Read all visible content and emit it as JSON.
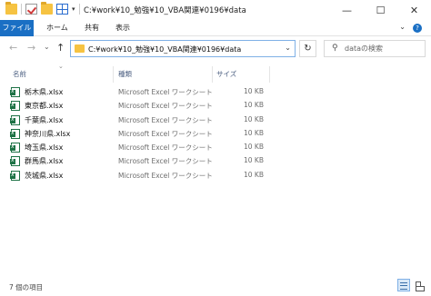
{
  "window": {
    "title": "C:¥work¥10_勉強¥10_VBA関連¥0196¥data",
    "minimize": "—",
    "maximize": "☐",
    "close": "✕"
  },
  "ribbon": {
    "tabs": [
      "ファイル",
      "ホーム",
      "共有",
      "表示"
    ],
    "help": "?",
    "expand": "⌄"
  },
  "nav": {
    "back": "←",
    "forward": "→",
    "recent": "⌄",
    "up": "↑",
    "address": "C:¥work¥10_勉強¥10_VBA関連¥0196¥data",
    "address_dropdown": "⌄",
    "refresh": "↻",
    "search_placeholder": "dataの検索",
    "search_icon": "⚲"
  },
  "columns": {
    "sort_indicator": "⌄",
    "name": "名前",
    "type": "種類",
    "size": "サイズ"
  },
  "files": [
    {
      "name": "栃木県.xlsx",
      "type": "Microsoft Excel ワークシート",
      "size": "10 KB",
      "icon": "excel-file-icon"
    },
    {
      "name": "東京都.xlsx",
      "type": "Microsoft Excel ワークシート",
      "size": "10 KB",
      "icon": "excel-file-icon"
    },
    {
      "name": "千葉県.xlsx",
      "type": "Microsoft Excel ワークシート",
      "size": "10 KB",
      "icon": "excel-file-icon"
    },
    {
      "name": "神奈川県.xlsx",
      "type": "Microsoft Excel ワークシート",
      "size": "10 KB",
      "icon": "excel-file-icon"
    },
    {
      "name": "埼玉県.xlsx",
      "type": "Microsoft Excel ワークシート",
      "size": "10 KB",
      "icon": "excel-file-icon"
    },
    {
      "name": "群馬県.xlsx",
      "type": "Microsoft Excel ワークシート",
      "size": "10 KB",
      "icon": "excel-file-icon"
    },
    {
      "name": "茨城県.xlsx",
      "type": "Microsoft Excel ワークシート",
      "size": "10 KB",
      "icon": "excel-file-icon"
    }
  ],
  "status": {
    "item_count": "7 個の項目"
  },
  "colors": {
    "accent": "#1a6fc4",
    "excel_green": "#1d7245",
    "folder_yellow": "#f6c342"
  }
}
